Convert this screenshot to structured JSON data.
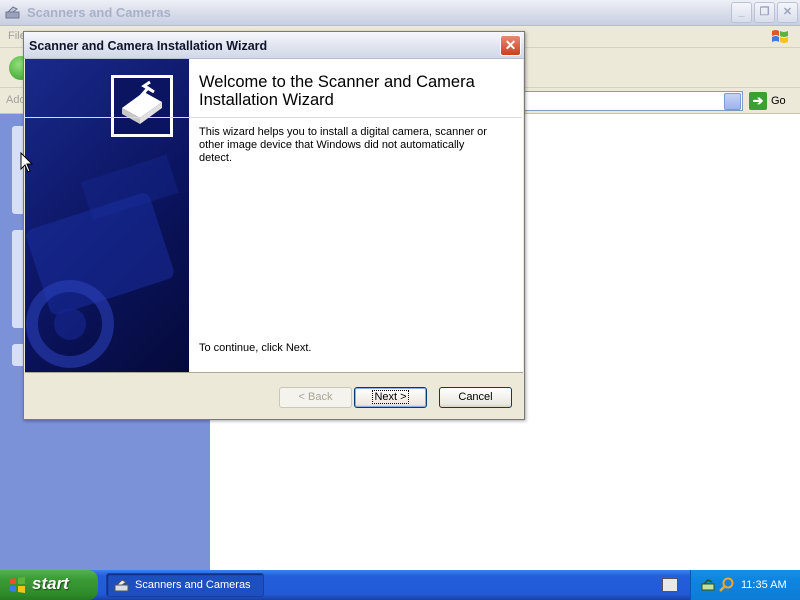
{
  "background_window": {
    "title": "Scanners and Cameras",
    "menu_file": "File",
    "address_label": "Address",
    "go_label": "Go"
  },
  "wizard": {
    "title": "Scanner and Camera Installation Wizard",
    "heading": "Welcome to the Scanner and Camera Installation Wizard",
    "description": "This wizard helps you to install a digital camera, scanner or other image device that Windows did not automatically detect.",
    "continue_text": "To continue, click Next.",
    "back_label": "< Back",
    "next_label": "Next >",
    "cancel_label": "Cancel"
  },
  "taskbar": {
    "start_label": "start",
    "task_label": "Scanners and Cameras",
    "clock": "11:35 AM"
  },
  "colors": {
    "banner": "#0b1460",
    "taskbar": "#245edb",
    "start": "#3c9b37"
  }
}
